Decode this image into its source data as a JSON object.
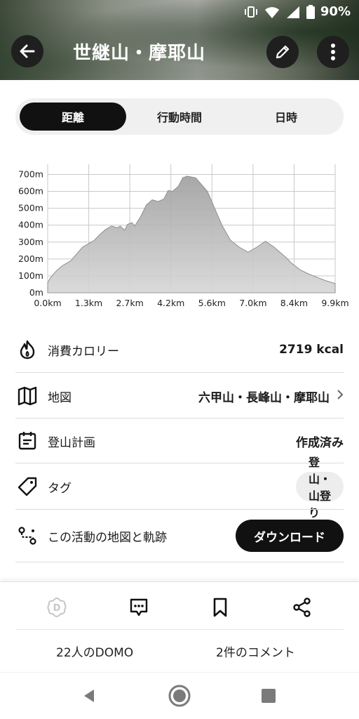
{
  "status": {
    "battery": "90%"
  },
  "header": {
    "title": "世継山・摩耶山"
  },
  "tabs": [
    {
      "label": "距離",
      "active": true
    },
    {
      "label": "行動時間",
      "active": false
    },
    {
      "label": "日時",
      "active": false
    }
  ],
  "chart_data": {
    "type": "area",
    "xlabel": "",
    "ylabel": "",
    "x_ticks": [
      "0.0km",
      "1.3km",
      "2.7km",
      "4.2km",
      "5.6km",
      "7.0km",
      "8.4km",
      "9.9km"
    ],
    "y_ticks": [
      "0m",
      "100m",
      "200m",
      "300m",
      "400m",
      "500m",
      "600m",
      "700m"
    ],
    "xlim": [
      0,
      9.9
    ],
    "ylim": [
      0,
      760
    ],
    "grid": true,
    "fill_color": "#b5b5b5",
    "x": [
      0,
      0.1,
      0.3,
      0.5,
      0.8,
      1.0,
      1.2,
      1.4,
      1.6,
      1.8,
      2.0,
      2.2,
      2.4,
      2.5,
      2.65,
      2.75,
      2.9,
      3.0,
      3.2,
      3.4,
      3.6,
      3.8,
      4.0,
      4.15,
      4.3,
      4.5,
      4.65,
      4.8,
      4.95,
      5.1,
      5.3,
      5.5,
      5.7,
      6.0,
      6.3,
      6.6,
      6.9,
      7.2,
      7.5,
      7.8,
      8.0,
      8.2,
      8.4,
      8.7,
      9.0,
      9.3,
      9.6,
      9.9
    ],
    "y": [
      60,
      90,
      130,
      160,
      190,
      230,
      270,
      290,
      310,
      345,
      375,
      395,
      385,
      395,
      370,
      405,
      415,
      395,
      450,
      520,
      550,
      540,
      555,
      605,
      600,
      630,
      680,
      690,
      685,
      680,
      640,
      600,
      520,
      400,
      310,
      270,
      240,
      270,
      305,
      270,
      240,
      210,
      175,
      135,
      110,
      90,
      70,
      55
    ]
  },
  "rows": {
    "calories": {
      "label": "消費カロリー",
      "value": "2719 kcal"
    },
    "map": {
      "label": "地図",
      "value": "六甲山・長峰山・摩耶山"
    },
    "plan": {
      "label": "登山計画",
      "value": "作成済み"
    },
    "tag": {
      "label": "タグ",
      "value": "登山・山登り"
    },
    "track": {
      "label": "この活動の地図と軌跡",
      "button": "ダウンロード"
    }
  },
  "actions": {
    "domo_count": "22人のDOMO",
    "comment_count": "2件のコメント"
  }
}
